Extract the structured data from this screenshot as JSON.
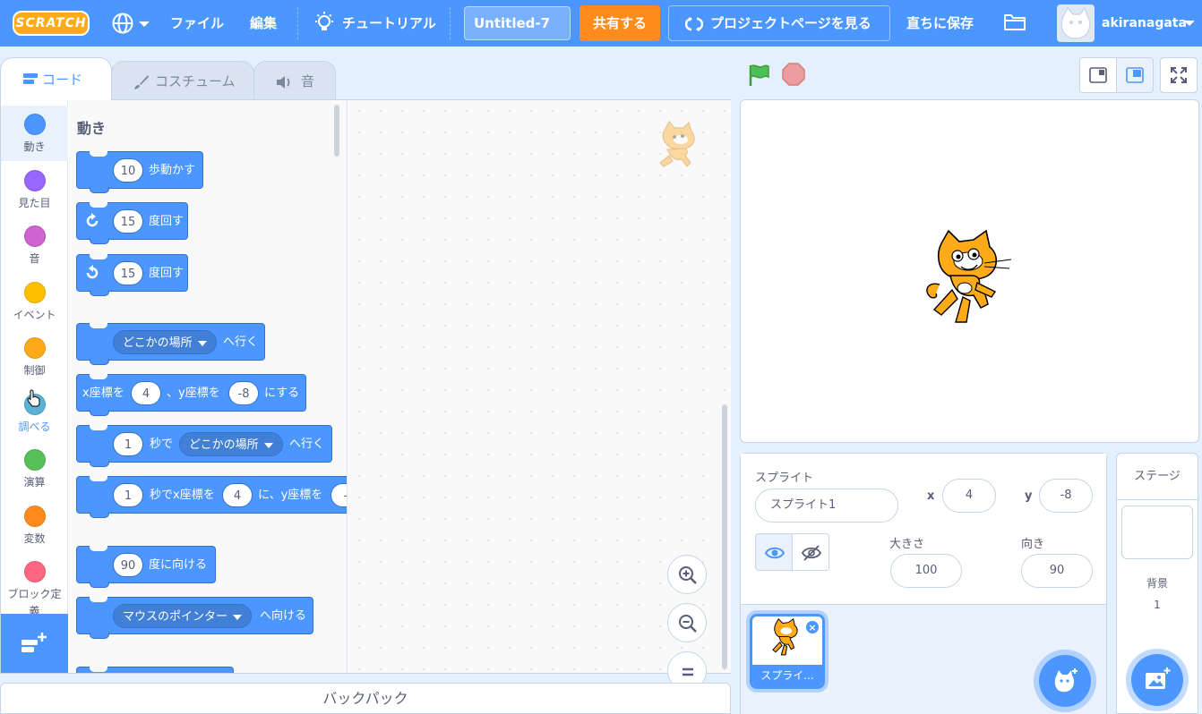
{
  "menubar": {
    "logo": "SCRATCH",
    "file": "ファイル",
    "edit": "編集",
    "tutorial": "チュートリアル",
    "title": "Untitled-7",
    "share": "共有する",
    "see_project": "プロジェクトページを見る",
    "save_now": "直ちに保存",
    "username": "akiranagata"
  },
  "tabs": {
    "code": "コード",
    "costumes": "コスチューム",
    "sounds": "音"
  },
  "categories": [
    {
      "label": "動き",
      "color": "#4c97ff"
    },
    {
      "label": "見た目",
      "color": "#9966ff"
    },
    {
      "label": "音",
      "color": "#cf63cf"
    },
    {
      "label": "イベント",
      "color": "#ffbf00"
    },
    {
      "label": "制御",
      "color": "#ffab19"
    },
    {
      "label": "調べる",
      "color": "#5cb1d6"
    },
    {
      "label": "演算",
      "color": "#59c059"
    },
    {
      "label": "変数",
      "color": "#ff8c1a"
    },
    {
      "label": "ブロック定義",
      "color": "#ff6680"
    }
  ],
  "palette": {
    "title": "動き",
    "move": {
      "value": "10",
      "text": "歩動かす"
    },
    "turn_right": {
      "value": "15",
      "text": "度回す"
    },
    "turn_left": {
      "value": "15",
      "text": "度回す"
    },
    "goto": {
      "dropdown": "どこかの場所",
      "text": "へ行く"
    },
    "goto_xy": {
      "t1": "x座標を",
      "x": "4",
      "t2": "、y座標を",
      "y": "-8",
      "t3": "にする"
    },
    "glide": {
      "secs": "1",
      "t1": "秒で",
      "dropdown": "どこかの場所",
      "t2": "へ行く"
    },
    "glide_xy": {
      "secs": "1",
      "t1": "秒でx座標を",
      "x": "4",
      "t2": "に、y座標を",
      "y": "-"
    },
    "point_dir": {
      "value": "90",
      "text": "度に向ける"
    },
    "point_towards": {
      "dropdown": "マウスのポインター",
      "text": "へ向ける"
    }
  },
  "backpack": "バックパック",
  "sprite_info": {
    "sprite_label": "スプライト",
    "sprite_name": "スプライト1",
    "x_label": "x",
    "x_value": "4",
    "y_label": "y",
    "y_value": "-8",
    "size_label": "大きさ",
    "size_value": "100",
    "direction_label": "向き",
    "direction_value": "90"
  },
  "sprite_list": {
    "tile_name": "スプライ..."
  },
  "stage_pane": {
    "title": "ステージ",
    "backdrops_label": "背景",
    "backdrops_count": "1"
  }
}
